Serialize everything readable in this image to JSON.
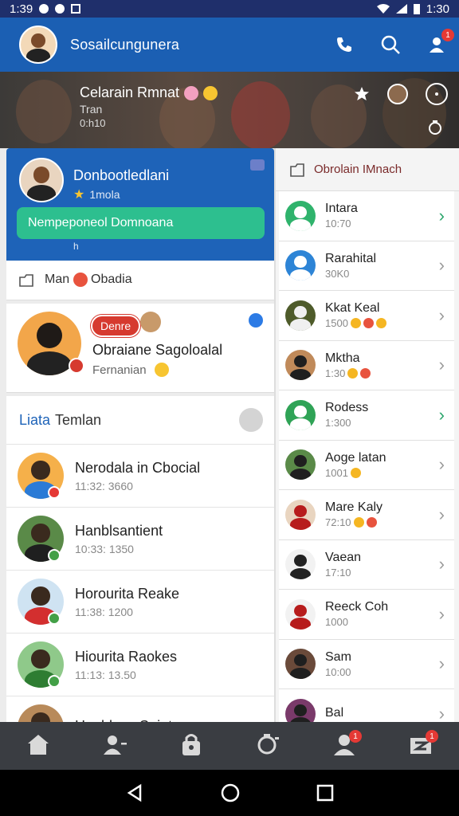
{
  "status_bar": {
    "time": "1:39",
    "battery_time": "1:30"
  },
  "app_bar": {
    "title": "Sosailcungunera",
    "notification_count": "1"
  },
  "hero": {
    "title": "Celarain Rmnat",
    "subtitle": "Tran",
    "time": "0:h10"
  },
  "profile_card": {
    "name": "Donbootledlani",
    "status": "1mola",
    "action_label": "Nempeponeol Domnoana",
    "hint": "h",
    "post_label": "Man",
    "post_label_2": "Obadia"
  },
  "story_card": {
    "tag": "Denre",
    "title": "Obraiane Sagoloalal",
    "subtitle": "Fernanian"
  },
  "friends": {
    "heading_a": "Liata",
    "heading_b": "Temlan",
    "items": [
      {
        "name": "Nerodala in Cbocial",
        "time": "11:32: 3660",
        "skin": "#f5b04a",
        "shirt": "#2b7bd6",
        "badge": "#e53935"
      },
      {
        "name": "Hanblsantient",
        "time": "10:33: 1350",
        "skin": "#5a8a48",
        "shirt": "#1f1f1f",
        "badge": "#43a047"
      },
      {
        "name": "Horourita Reake",
        "time": "11:38: 1200",
        "skin": "#cfe3f2",
        "shirt": "#d32f2f",
        "badge": "#43a047"
      },
      {
        "name": "Hiourita Raokes",
        "time": "11:13: 13.50",
        "skin": "#8fc98a",
        "shirt": "#2e7d32",
        "badge": "#43a047"
      },
      {
        "name": "Haoblsao Sojot",
        "time": "",
        "skin": "#b88a5a",
        "shirt": "#1f1f1f",
        "badge": "#43a047"
      }
    ]
  },
  "chat_panel": {
    "heading": "Obrolain IMnach",
    "items": [
      {
        "name": "Intara",
        "sub": "10:70",
        "bg": "#2fb36c",
        "fg": "#ffffff",
        "chev_green": true,
        "emojis": 0
      },
      {
        "name": "Rarahital",
        "sub": "30K0",
        "bg": "#2d84d6",
        "fg": "#ffffff",
        "chev_green": false,
        "emojis": 0
      },
      {
        "name": "Kkat Keal",
        "sub": "1500",
        "bg": "#4e5b2a",
        "fg": "#f0f0f0",
        "chev_green": false,
        "emojis": 3
      },
      {
        "name": "Mktha",
        "sub": "1:30",
        "bg": "#c08a5a",
        "fg": "#1f1f1f",
        "chev_green": false,
        "emojis": 2
      },
      {
        "name": "Rodess",
        "sub": "1:300",
        "bg": "#2fa356",
        "fg": "#ffffff",
        "chev_green": true,
        "emojis": 0
      },
      {
        "name": "Aoge latan",
        "sub": "1001",
        "bg": "#5a8a48",
        "fg": "#1f1f1f",
        "chev_green": false,
        "emojis": 1
      },
      {
        "name": "Mare Kaly",
        "sub": "72:10",
        "bg": "#e9d5c0",
        "fg": "#b71c1c",
        "chev_green": false,
        "emojis": 2
      },
      {
        "name": "Vaean",
        "sub": "17:10",
        "bg": "#f2f2f2",
        "fg": "#222222",
        "chev_green": false,
        "emojis": 0
      },
      {
        "name": "Reeck Coh",
        "sub": "1000",
        "bg": "#f2f2f2",
        "fg": "#b71c1c",
        "chev_green": false,
        "emojis": 0
      },
      {
        "name": "Sam",
        "sub": "10:00",
        "bg": "#6a4a3a",
        "fg": "#1f1f1f",
        "chev_green": false,
        "emojis": 0
      },
      {
        "name": "Bal",
        "sub": "",
        "bg": "#7a3a6a",
        "fg": "#1f1f1f",
        "chev_green": false,
        "emojis": 0
      }
    ]
  },
  "bottom_nav": {
    "items": [
      {
        "icon": "home-icon",
        "badge": ""
      },
      {
        "icon": "add-friend-icon",
        "badge": ""
      },
      {
        "icon": "lock-icon",
        "badge": ""
      },
      {
        "icon": "camera-icon",
        "badge": ""
      },
      {
        "icon": "person-icon",
        "badge": "1"
      },
      {
        "icon": "inbox-icon",
        "badge": "1"
      }
    ]
  },
  "colors": {
    "primary": "#1b5fb3",
    "accent_green": "#2dbf8f",
    "nav_bg": "#3a3d42",
    "badge_red": "#e53935"
  }
}
